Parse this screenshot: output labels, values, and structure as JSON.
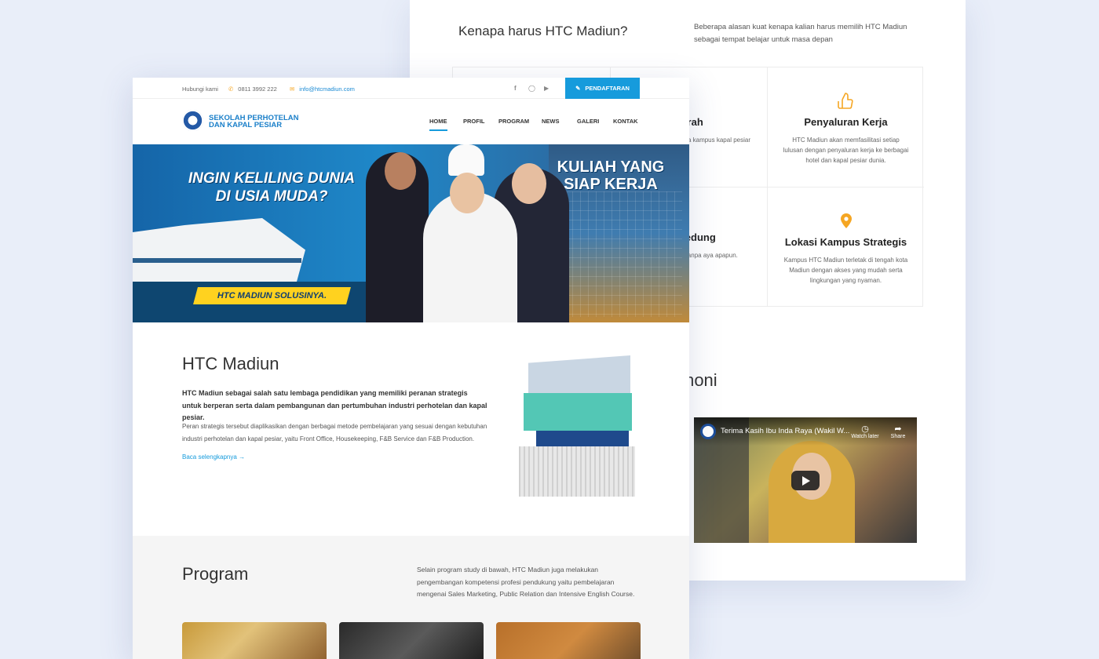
{
  "back_page": {
    "why_title": "Kenapa harus HTC Madiun?",
    "why_desc": "Beberapa alasan kuat kenapa kalian harus memilih HTC Madiun sebagai tempat belajar untuk masa depan",
    "features": [
      {
        "title": "dikan Murah",
        "text": "kuliah di HTC Madiun rah diantara kampus kapal pesiar lain.",
        "icon": "money-icon"
      },
      {
        "title": "Penyaluran Kerja",
        "text": "HTC Madiun akan memfasilitasi setiap lulusan dengan penyaluran kerja ke berbagai hotel dan kapal pesiar dunia.",
        "icon": "thumbs-up-icon"
      },
      {
        "title": "sulanan dan Gedung",
        "text": "an kemudahan dengan ONE FOR ALL tanpa aya apapun.",
        "icon": "star-icon"
      },
      {
        "title": "Lokasi Kampus Strategis",
        "text": "Kampus HTC Madiun terletak di tengah kota Madiun dengan akses yang mudah serta lingkungan yang nyaman.",
        "icon": "map-pin-icon"
      }
    ],
    "testimoni_title": "moni",
    "video": {
      "title": "Terima Kasih Ibu Inda Raya (Wakil W...",
      "watch_later": "Watch later",
      "share": "Share"
    }
  },
  "front_page": {
    "topbar": {
      "contact_label": "Hubungi kami",
      "phone": "0811 3992 222",
      "email": "info@htcmadiun.com",
      "cta": "PENDAFTARAN"
    },
    "logo": {
      "line1": "SEKOLAH PERHOTELAN",
      "line2": "DAN KAPAL PESIAR"
    },
    "nav": [
      "HOME",
      "PROFIL",
      "PROGRAM",
      "NEWS",
      "GALERI",
      "KONTAK"
    ],
    "hero": {
      "headline_left": "INGIN KELILING DUNIA DI USIA MUDA?",
      "headline_right": "KULIAH YANG SIAP KERJA",
      "tagline": "HTC MADIUN SOLUSINYA."
    },
    "about": {
      "title": "HTC Madiun",
      "lead": "HTC Madiun sebagai salah satu lembaga pendidikan yang memiliki peranan strategis untuk berperan serta dalam pembangunan dan pertumbuhan industri perhotelan dan kapal pesiar.",
      "body": "Peran strategis tersebut diaplikasikan dengan berbagai metode pembelajaran yang sesuai dengan kebutuhan industri perhotelan dan kapal pesiar, yaitu Front Office, Housekeeping, F&B Service dan F&B Production.",
      "link": "Baca selengkapnya"
    },
    "program": {
      "title": "Program",
      "desc": "Selain program study di bawah, HTC Madiun juga melakukan pengembangan kompetensi profesi pendukung yaitu pembelajaran mengenai Sales Marketing, Public Relation dan Intensive English Course."
    }
  },
  "colors": {
    "accent": "#169bdc",
    "icon_yellow": "#f5a623",
    "tag_yellow": "#ffd21f"
  }
}
